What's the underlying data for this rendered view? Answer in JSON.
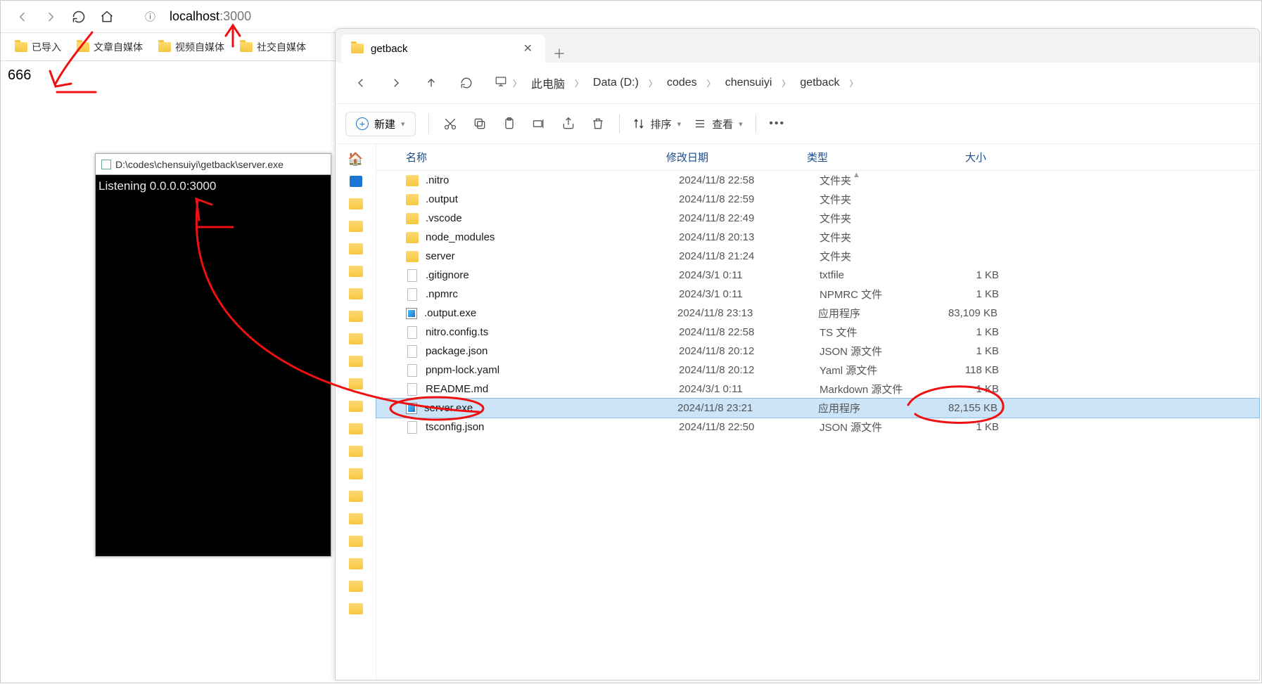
{
  "browser": {
    "url_host": "localhost",
    "url_port": ":3000",
    "bookmarks": [
      "已导入",
      "文章自媒体",
      "视频自媒体",
      "社交自媒体"
    ],
    "page_text": "666"
  },
  "terminal": {
    "title": "D:\\codes\\chensuiyi\\getback\\server.exe",
    "line": "Listening 0.0.0.0:3000"
  },
  "explorer": {
    "tab": "getback",
    "toolbar": {
      "new": "新建",
      "sort": "排序",
      "view": "查看"
    },
    "breadcrumb": [
      "此电脑",
      "Data (D:)",
      "codes",
      "chensuiyi",
      "getback"
    ],
    "columns": {
      "name": "名称",
      "date": "修改日期",
      "type": "类型",
      "size": "大小"
    },
    "files": [
      {
        "name": ".nitro",
        "date": "2024/11/8 22:58",
        "type": "文件夹",
        "size": "",
        "icon": "folder"
      },
      {
        "name": ".output",
        "date": "2024/11/8 22:59",
        "type": "文件夹",
        "size": "",
        "icon": "folder"
      },
      {
        "name": ".vscode",
        "date": "2024/11/8 22:49",
        "type": "文件夹",
        "size": "",
        "icon": "folder"
      },
      {
        "name": "node_modules",
        "date": "2024/11/8 20:13",
        "type": "文件夹",
        "size": "",
        "icon": "folder"
      },
      {
        "name": "server",
        "date": "2024/11/8 21:24",
        "type": "文件夹",
        "size": "",
        "icon": "folder"
      },
      {
        "name": ".gitignore",
        "date": "2024/3/1 0:11",
        "type": "txtfile",
        "size": "1 KB",
        "icon": "file"
      },
      {
        "name": ".npmrc",
        "date": "2024/3/1 0:11",
        "type": "NPMRC 文件",
        "size": "1 KB",
        "icon": "file"
      },
      {
        "name": ".output.exe",
        "date": "2024/11/8 23:13",
        "type": "应用程序",
        "size": "83,109 KB",
        "icon": "exe"
      },
      {
        "name": "nitro.config.ts",
        "date": "2024/11/8 22:58",
        "type": "TS 文件",
        "size": "1 KB",
        "icon": "file"
      },
      {
        "name": "package.json",
        "date": "2024/11/8 20:12",
        "type": "JSON 源文件",
        "size": "1 KB",
        "icon": "file"
      },
      {
        "name": "pnpm-lock.yaml",
        "date": "2024/11/8 20:12",
        "type": "Yaml 源文件",
        "size": "118 KB",
        "icon": "file"
      },
      {
        "name": "README.md",
        "date": "2024/3/1 0:11",
        "type": "Markdown 源文件",
        "size": "1 KB",
        "icon": "file"
      },
      {
        "name": "server.exe",
        "date": "2024/11/8 23:21",
        "type": "应用程序",
        "size": "82,155 KB",
        "icon": "exe",
        "selected": true
      },
      {
        "name": "tsconfig.json",
        "date": "2024/11/8 22:50",
        "type": "JSON 源文件",
        "size": "1 KB",
        "icon": "file"
      }
    ]
  }
}
